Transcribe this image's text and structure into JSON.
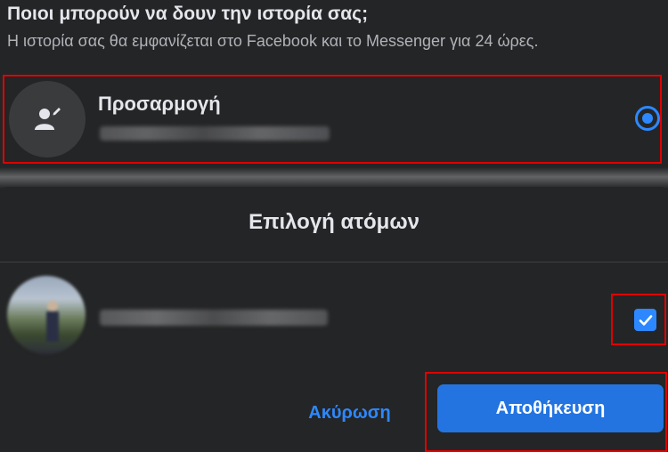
{
  "header": {
    "title": "Ποιοι μπορούν να δουν την ιστορία σας;",
    "subtitle": "Η ιστορία σας θα εμφανίζεται στο Facebook και το Messenger για 24 ώρες."
  },
  "audience_option": {
    "label": "Προσαρμογή",
    "icon": "person-edit-icon",
    "selected": true
  },
  "dialog": {
    "title": "Επιλογή ατόμων",
    "people": [
      {
        "checked": true
      }
    ],
    "cancel_label": "Ακύρωση",
    "save_label": "Αποθήκευση"
  },
  "colors": {
    "background": "#242526",
    "accent": "#2d88ff",
    "primary_button": "#2374e1",
    "highlight_box": "#e00000"
  }
}
